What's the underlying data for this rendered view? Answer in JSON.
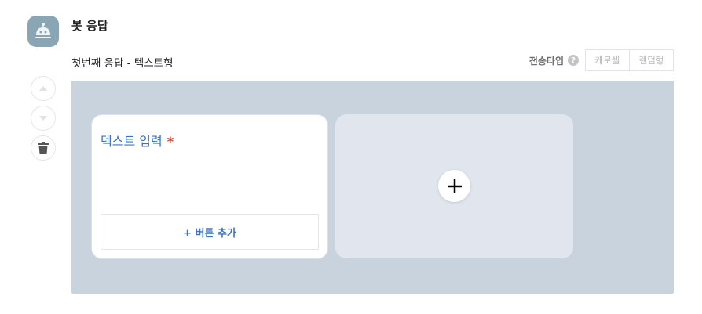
{
  "bot": {
    "avatar_icon": "robot-icon",
    "title": "봇 응답"
  },
  "response": {
    "subtitle": "첫번째 응답 - 텍스트형"
  },
  "send_type": {
    "label": "전송타입",
    "help_symbol": "?",
    "options": [
      "케로셀",
      "랜덤형"
    ]
  },
  "side_controls": {
    "icons": [
      "move-up-icon",
      "move-down-icon",
      "trash-icon"
    ]
  },
  "card": {
    "title": "텍스트 입력",
    "required_mark": "*",
    "add_button_label": "+ 버튼 추가"
  },
  "add_card": {
    "icon": "plus-icon"
  },
  "colors": {
    "accent": "#3a74c4",
    "required": "#e0302a",
    "canvas_bg": "#c8d3de",
    "add_card_bg": "#e1e6ee",
    "avatar_bg": "#8aa6b5"
  }
}
